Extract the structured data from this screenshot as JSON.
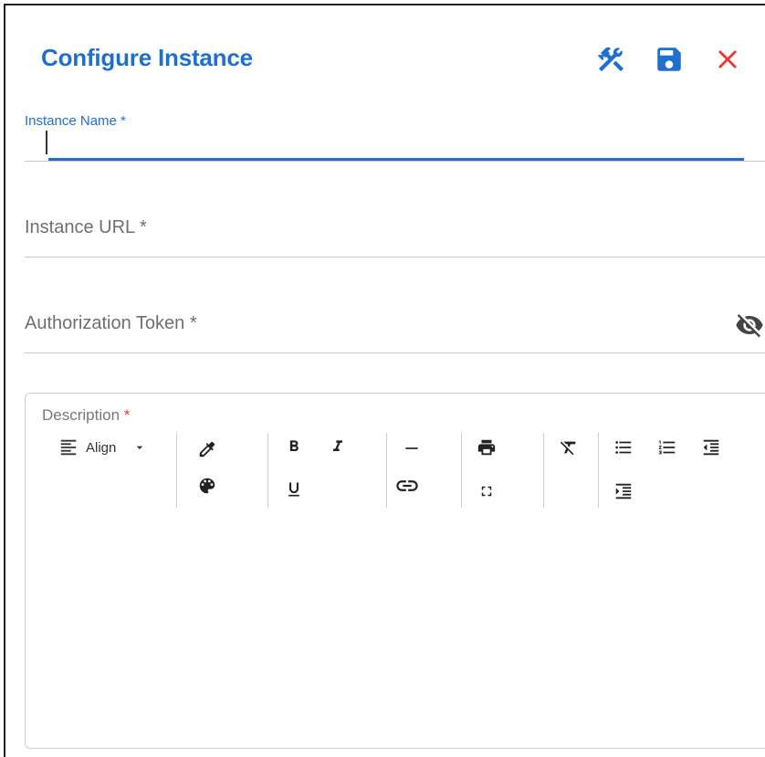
{
  "dialog": {
    "title": "Configure Instance",
    "accent_color": "#1e6fd0",
    "close_color": "#e53935"
  },
  "header_actions": [
    {
      "name": "tools-icon"
    },
    {
      "name": "save-icon"
    },
    {
      "name": "close-icon"
    }
  ],
  "fields": {
    "instance_name": {
      "label": "Instance Name *",
      "value": ""
    },
    "instance_url": {
      "label": "Instance URL *",
      "value": ""
    },
    "auth_token": {
      "label": "Authorization Token *",
      "value": "",
      "visibility_icon": "eye-off-icon"
    }
  },
  "description": {
    "label": "Description",
    "required_mark": "*",
    "toolbar": {
      "align_label": "Align",
      "icons": [
        "align-left-icon",
        "chevron-down-icon",
        "color-picker-icon",
        "palette-icon",
        "bold-icon",
        "italic-icon",
        "underline-icon",
        "horizontal-rule-icon",
        "link-icon",
        "print-icon",
        "fullscreen-icon",
        "clear-format-icon",
        "bullet-list-icon",
        "numbered-list-icon",
        "outdent-icon",
        "indent-icon"
      ]
    }
  }
}
